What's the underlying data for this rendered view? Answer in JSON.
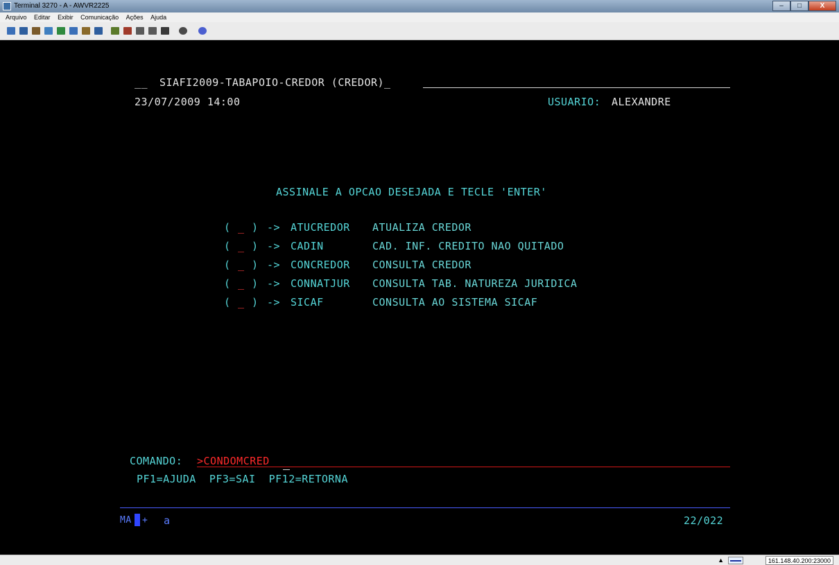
{
  "window": {
    "title": "Terminal 3270 - A - AWVR2225",
    "controls": {
      "minimize": "–",
      "maximize": "□",
      "close": "X"
    }
  },
  "menu": {
    "items": [
      "Arquivo",
      "Editar",
      "Exibir",
      "Comunicação",
      "Ações",
      "Ajuda"
    ]
  },
  "toolbar": {
    "buttons": [
      {
        "icon": "print-screen-icon",
        "color": "#3a6fb8"
      },
      {
        "icon": "copy-screen-icon",
        "color": "#2e5e9e"
      },
      {
        "icon": "paste-icon",
        "color": "#7a5a2a"
      },
      {
        "icon": "copy-icon",
        "color": "#3f7fc0"
      },
      {
        "icon": "paste-link-icon",
        "color": "#2f8a3f"
      },
      {
        "icon": "session-icon",
        "color": "#3a6fb8"
      },
      {
        "icon": "macro-icon",
        "color": "#8a6a2a"
      },
      {
        "icon": "keyboard-icon",
        "color": "#2e5e9e"
      },
      {
        "icon": "send-file-icon",
        "color": "#5b7a2a"
      },
      {
        "icon": "receive-file-icon",
        "color": "#a03a2a"
      },
      {
        "icon": "transfer-icon",
        "color": "#5a5a5a"
      },
      {
        "icon": "record-icon",
        "color": "#5a5a5a"
      },
      {
        "icon": "display-icon",
        "color": "#3a3a3a"
      },
      {
        "icon": "settings-icon",
        "color": "#4a4a4a"
      },
      {
        "icon": "help-icon",
        "color": "#4b5fd0"
      }
    ]
  },
  "terminal": {
    "header_prefix": "__",
    "header_title": "SIAFI2009-TABAPOIO-CREDOR (CREDOR)_",
    "datetime": "23/07/2009 14:00",
    "user_label": "USUARIO:",
    "user_name": "ALEXANDRE",
    "instruction": "ASSINALE A OPCAO DESEJADA E TECLE 'ENTER'",
    "options": [
      {
        "open": "(",
        "field": "_",
        "close": ")",
        "arrow": "->",
        "code": "ATUCREDOR",
        "desc": "ATUALIZA CREDOR"
      },
      {
        "open": "(",
        "field": "_",
        "close": ")",
        "arrow": "->",
        "code": "CADIN",
        "desc": "CAD. INF. CREDITO NAO QUITADO"
      },
      {
        "open": "(",
        "field": "_",
        "close": ")",
        "arrow": "->",
        "code": "CONCREDOR",
        "desc": "CONSULTA CREDOR"
      },
      {
        "open": "(",
        "field": "_",
        "close": ")",
        "arrow": "->",
        "code": "CONNATJUR",
        "desc": "CONSULTA TAB. NATUREZA JURIDICA"
      },
      {
        "open": "(",
        "field": "_",
        "close": ")",
        "arrow": "->",
        "code": "SICAF",
        "desc": "CONSULTA AO SISTEMA SICAF"
      }
    ],
    "command_label": "COMANDO:",
    "command_value": ">CONDOMCRED",
    "function_keys": "PF1=AJUDA  PF3=SAI  PF12=RETORNA",
    "oia_mode": "MA",
    "oia_plus": "+",
    "oia_letter": "a",
    "cursor_position": "22/022"
  },
  "status": {
    "arrow": "▲",
    "host": "161.148.40.200:23000"
  },
  "colors": {
    "screen_bg": "#000000",
    "field_text": "#55d6d8",
    "protected_text": "#e6e6e6",
    "input_text": "#ff2a2a",
    "oia_line": "#4a5cff"
  }
}
